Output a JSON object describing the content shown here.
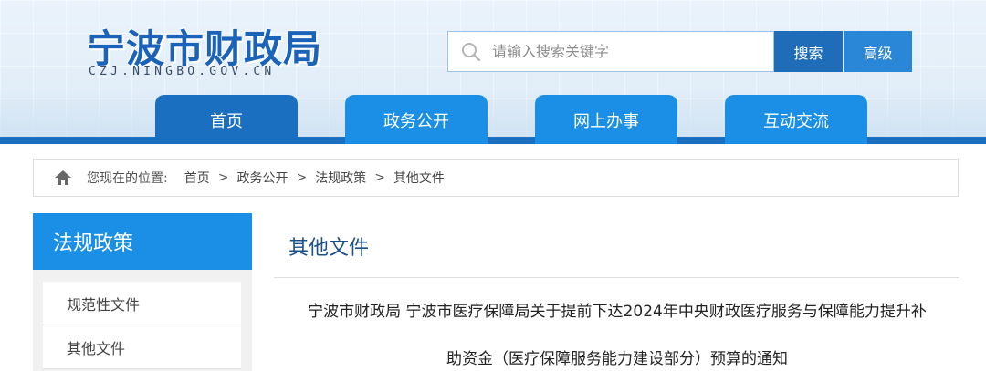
{
  "header": {
    "site_title": "宁波市财政局",
    "site_domain": "CZJ.NINGBO.GOV.CN"
  },
  "search": {
    "placeholder": "请输入搜索关键字",
    "search_button": "搜索",
    "advanced_button": "高级"
  },
  "nav": {
    "tabs": [
      {
        "label": "首页",
        "active": true
      },
      {
        "label": "政务公开",
        "active": false
      },
      {
        "label": "网上办事",
        "active": false
      },
      {
        "label": "互动交流",
        "active": false
      }
    ]
  },
  "breadcrumb": {
    "prefix": "您现在的位置:",
    "items": [
      "首页",
      "政务公开",
      "法规政策",
      "其他文件"
    ],
    "separator": ">"
  },
  "sidebar": {
    "title": "法规政策",
    "items": [
      {
        "label": "规范性文件"
      },
      {
        "label": "其他文件"
      }
    ]
  },
  "main": {
    "section_title": "其他文件",
    "article_title_line1": "宁波市财政局 宁波市医疗保障局关于提前下达2024年中央财政医疗服务与保障能力提升补",
    "article_title_line2": "助资金（医疗保障服务能力建设部分）预算的通知"
  },
  "colors": {
    "brand_blue": "#1a6fc1",
    "tab_blue": "#1b8ee6",
    "title_blue": "#1a63b8"
  }
}
